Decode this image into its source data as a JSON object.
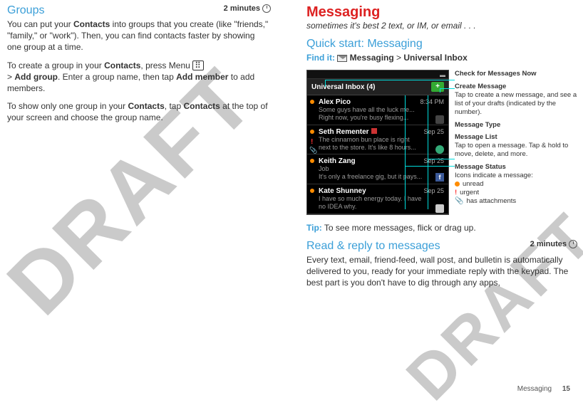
{
  "left": {
    "heading": "Groups",
    "badge": "2 minutes",
    "p1a": "You can put your ",
    "p1b": "Contacts",
    "p1c": " into groups that you create (like \"friends,\" \"family,\" or \"work\"). Then, you can find contacts faster by showing one group at a time.",
    "p2a": "To create a group in your ",
    "p2b": "Contacts",
    "p2c": ", press Menu ",
    "p2d": "> ",
    "p2e": "Add group",
    "p2f": ". Enter a group name, then tap ",
    "p2g": "Add member",
    "p2h": " to add members.",
    "p3a": "To show only one group in your ",
    "p3b": "Contacts",
    "p3c": ", tap ",
    "p3d": "Contacts",
    "p3e": " at the top of your screen and choose the group name."
  },
  "right": {
    "heading": "Messaging",
    "subtitle": "sometimes it's best 2 text, or IM, or email . . .",
    "qs": "Quick start: Messaging",
    "findit": "Find it:",
    "findpath_a": "Messaging",
    "findsep": " > ",
    "findpath_b": "Universal Inbox",
    "tip_label": "Tip:",
    "tip_text": " To see more messages, flick or drag up.",
    "rr_heading": "Read & reply to messages",
    "rr_badge": "2 minutes",
    "rr_body": "Every text, email, friend-feed, wall post, and bulletin is automatically delivered to you, ready for your immediate reply with the keypad. The best part is you don't have to dig through any apps,"
  },
  "phone": {
    "header": "Universal Inbox (4)",
    "plus": "+",
    "msgs": [
      {
        "name": "Alex Pico",
        "time": "8:34 PM",
        "l1": "Some guys have all the luck me...",
        "l2": "Right now, you're busy flexing..."
      },
      {
        "name": "Seth Rementer",
        "time": "Sep 25",
        "l1": "The cinnamon bun place is right",
        "l2": "next to the store. It's like 8 hours..."
      },
      {
        "name": "Keith Zang",
        "time": "Sep 25",
        "l1": "Job",
        "l2": "It's only a freelance gig, but it pays..."
      },
      {
        "name": "Kate Shunney",
        "time": "Sep 25",
        "l1": "I have so much energy today. I have",
        "l2": "no IDEA why."
      }
    ]
  },
  "callouts": {
    "c1": {
      "t": "Check for Messages Now"
    },
    "c2": {
      "t": "Create Message",
      "d": "Tap to create a new message, and see a list of your drafts (indicated by the number)."
    },
    "c3": {
      "t": "Message Type"
    },
    "c4": {
      "t": "Message List",
      "d": "Tap to open a message. Tap & hold to move, delete, and more."
    },
    "c5": {
      "t": "Message Status",
      "d": "Icons indicate a message:",
      "i1": "unread",
      "i2": "urgent",
      "i3": "has attachments"
    }
  },
  "footer": {
    "section": "Messaging",
    "page": "15"
  },
  "watermark": "DRAFT"
}
